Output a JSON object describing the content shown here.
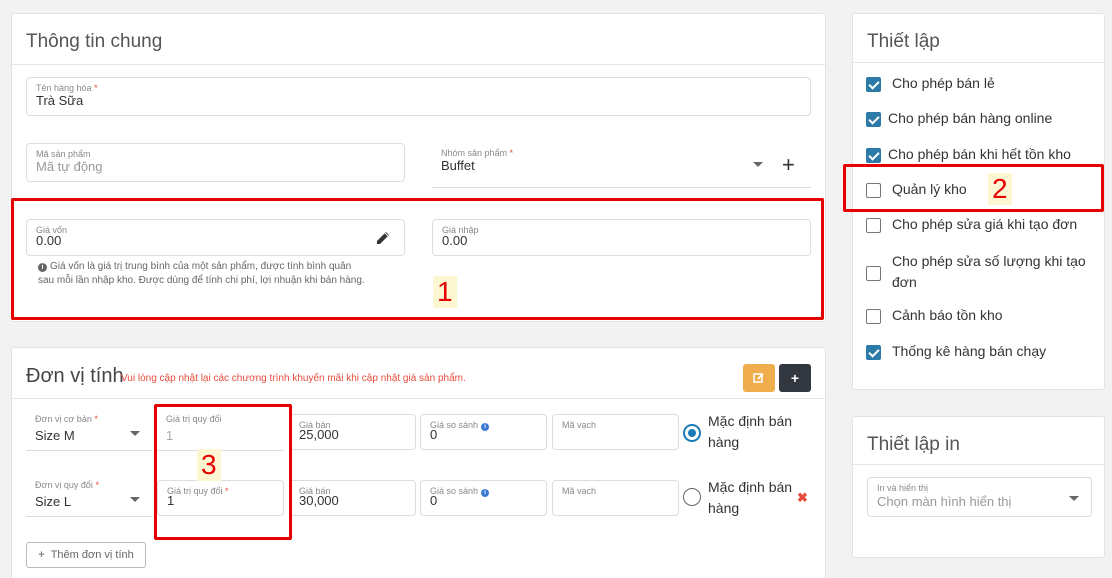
{
  "general": {
    "title": "Thông tin chung",
    "product_name": {
      "label": "Tên hàng hóa",
      "required": "*",
      "value": "Trà Sữa"
    },
    "product_code": {
      "label": "Mã sản phẩm",
      "placeholder": "Mã tự động"
    },
    "product_group": {
      "label": "Nhóm sản phẩm",
      "required": "*",
      "value": "Buffet"
    },
    "cost_price": {
      "label": "Giá vốn",
      "value": "0.00"
    },
    "import_price": {
      "label": "Giá nhập",
      "value": "0.00"
    },
    "cost_note_line1": "Giá vốn là giá trị trung bình của một sản phẩm, được tính bình quân",
    "cost_note_line2": "sau mỗi lần nhập kho. Được dùng để tính chi phí, lợi nhuận khi bán hàng."
  },
  "units": {
    "title": "Đơn vị tính",
    "warning": "Vui lòng cập nhật lại các chương trình khuyến mãi khi cập nhật giá sản phẩm.",
    "row1": {
      "unit_label": "Đơn vị cơ bản",
      "unit_value": "Size M",
      "conv_label": "Giá trị quy đổi",
      "conv_value": "1",
      "price_label": "Giá bán",
      "price_value": "25,000",
      "compare_label": "Giá so sánh",
      "compare_value": "0",
      "barcode_label": "Mã vạch",
      "barcode_value": "",
      "default_line1": "Mặc định bán",
      "default_line2": "hàng"
    },
    "row2": {
      "unit_label": "Đơn vị quy đổi",
      "unit_value": "Size L",
      "conv_label": "Giá trị quy đổi",
      "conv_value": "1",
      "price_label": "Giá bán",
      "price_value": "30,000",
      "compare_label": "Giá so sánh",
      "compare_value": "0",
      "barcode_label": "Mã vạch",
      "barcode_value": "",
      "default_line1": "Mặc định bán",
      "default_line2": "hàng"
    },
    "add_unit_label": "Thêm đơn vị tính",
    "required": "*"
  },
  "settings": {
    "title": "Thiết lập",
    "items": [
      {
        "label": "Cho phép bán lẻ",
        "checked": true
      },
      {
        "label": "Cho phép bán hàng online",
        "checked": true
      },
      {
        "label": "Cho phép bán khi hết tồn kho",
        "checked": true
      },
      {
        "label": "Quản lý kho",
        "checked": false
      },
      {
        "label": "Cho phép sửa giá khi tạo đơn",
        "checked": false
      },
      {
        "label": "Cho phép sửa số lượng khi tạo đơn",
        "checked": false
      },
      {
        "label": "Cảnh báo tồn kho",
        "checked": false
      },
      {
        "label": "Thống kê hàng bán chạy",
        "checked": true
      }
    ]
  },
  "print_settings": {
    "title": "Thiết lập in",
    "display": {
      "label": "In và hiển thị",
      "placeholder": "Chọn màn hình hiển thị"
    }
  },
  "annotations": {
    "m1": "1",
    "m2": "2",
    "m3": "3"
  },
  "colors": {
    "accent_blue": "#2b7aa8",
    "warning_orange": "#f0ad4e",
    "dark_button": "#333740",
    "annotation_red": "#e60000"
  }
}
